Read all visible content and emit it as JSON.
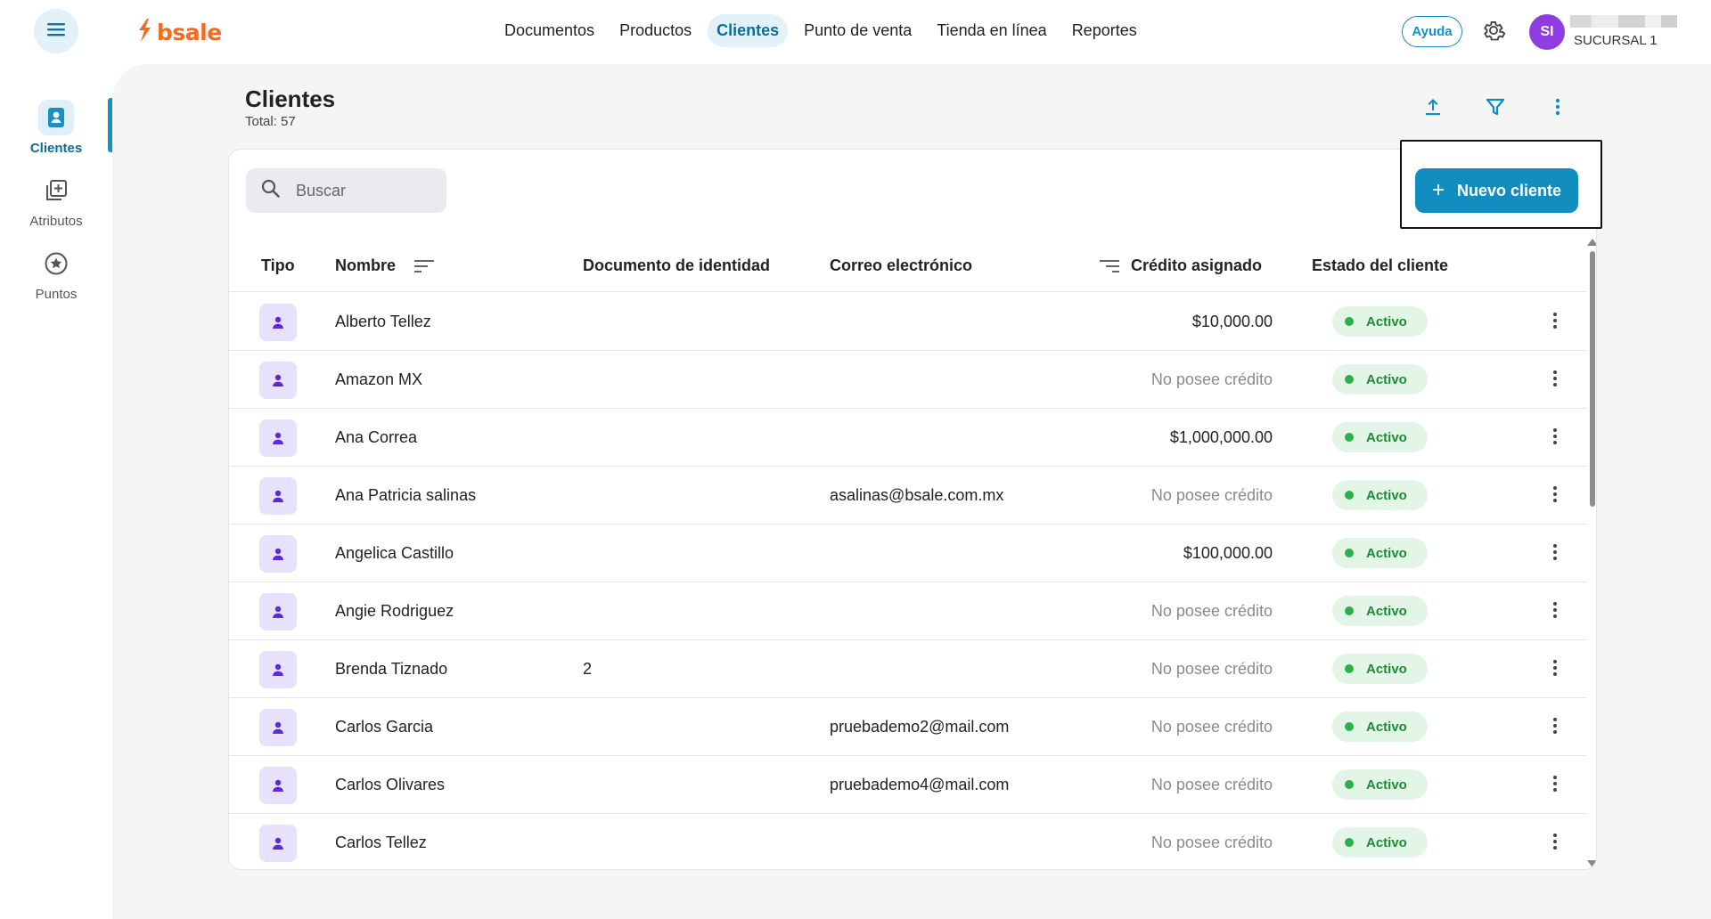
{
  "header": {
    "logo_text": "bsale",
    "nav": [
      "Documentos",
      "Productos",
      "Clientes",
      "Punto de venta",
      "Tienda en línea",
      "Reportes"
    ],
    "active_nav": "Clientes",
    "help_label": "Ayuda",
    "avatar_initials": "SI",
    "branch": "SUCURSAL 1"
  },
  "sidebar": {
    "items": [
      {
        "label": "Clientes",
        "icon": "contact-card-icon",
        "active": true
      },
      {
        "label": "Atributos",
        "icon": "add-library-icon",
        "active": false
      },
      {
        "label": "Puntos",
        "icon": "star-circle-icon",
        "active": false
      }
    ]
  },
  "page": {
    "title": "Clientes",
    "total": "Total: 57",
    "search_placeholder": "Buscar",
    "new_button": "Nuevo cliente",
    "new_button_icon": "+"
  },
  "table": {
    "columns": {
      "tipo": "Tipo",
      "nombre": "Nombre",
      "documento": "Documento de identidad",
      "correo": "Correo electrónico",
      "credito": "Crédito asignado",
      "estado": "Estado del cliente"
    },
    "rows": [
      {
        "nombre": "Alberto Tellez",
        "documento": "",
        "correo": "",
        "credito": "$10,000.00",
        "credito_muted": false,
        "estado": "Activo"
      },
      {
        "nombre": "Amazon MX",
        "documento": "",
        "correo": "",
        "credito": "No posee crédito",
        "credito_muted": true,
        "estado": "Activo"
      },
      {
        "nombre": "Ana Correa",
        "documento": "",
        "correo": "",
        "credito": "$1,000,000.00",
        "credito_muted": false,
        "estado": "Activo"
      },
      {
        "nombre": "Ana Patricia salinas",
        "documento": "",
        "correo": "asalinas@bsale.com.mx",
        "credito": "No posee crédito",
        "credito_muted": true,
        "estado": "Activo"
      },
      {
        "nombre": "Angelica Castillo",
        "documento": "",
        "correo": "",
        "credito": "$100,000.00",
        "credito_muted": false,
        "estado": "Activo"
      },
      {
        "nombre": "Angie Rodriguez",
        "documento": "",
        "correo": "",
        "credito": "No posee crédito",
        "credito_muted": true,
        "estado": "Activo"
      },
      {
        "nombre": "Brenda Tiznado",
        "documento": "2",
        "correo": "",
        "credito": "No posee crédito",
        "credito_muted": true,
        "estado": "Activo"
      },
      {
        "nombre": "Carlos Garcia",
        "documento": "",
        "correo": "pruebademo2@mail.com",
        "credito": "No posee crédito",
        "credito_muted": true,
        "estado": "Activo"
      },
      {
        "nombre": "Carlos Olivares",
        "documento": "",
        "correo": "pruebademo4@mail.com",
        "credito": "No posee crédito",
        "credito_muted": true,
        "estado": "Activo"
      },
      {
        "nombre": "Carlos Tellez",
        "documento": "",
        "correo": "",
        "credito": "No posee crédito",
        "credito_muted": true,
        "estado": "Activo"
      }
    ]
  },
  "colors": {
    "brand": "#f26b21",
    "accent": "#128dbf",
    "status_active": "#2bb04a",
    "type_badge": "#e7e1fb",
    "type_icon": "#5b2bd6"
  }
}
